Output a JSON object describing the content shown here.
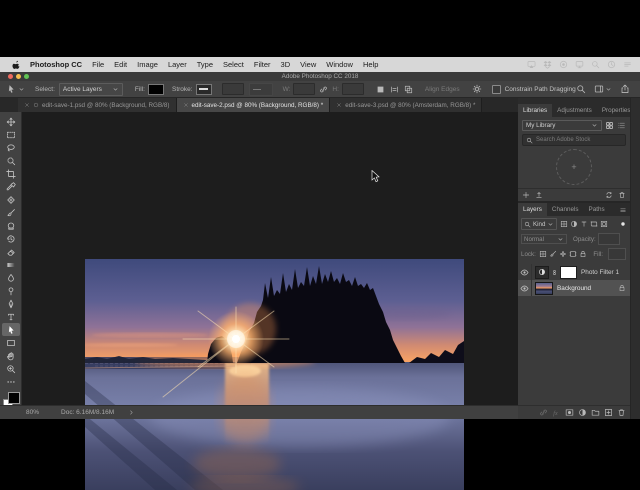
{
  "colors": {
    "menubar_bg": "#d7d7d7",
    "titlebar_bg": "#3a3a3a",
    "panel_bg": "#3b3b3b",
    "canvas_bg": "#1d1d1d",
    "selected_layer_bg": "#525252",
    "traffic_red": "#ee6a5f",
    "traffic_yellow": "#f5bd4f",
    "traffic_green": "#61c354"
  },
  "menu_bar": {
    "app_menu": "Photoshop CC",
    "items": [
      "File",
      "Edit",
      "Image",
      "Layer",
      "Type",
      "Select",
      "Filter",
      "3D",
      "View",
      "Window",
      "Help"
    ],
    "status_icons": [
      "airplay-icon",
      "dropbox-icon",
      "screen-record-icon",
      "display-icon",
      "spotlight-icon",
      "clock-icon",
      "notification-list-icon"
    ]
  },
  "window_title": "Adobe Photoshop CC 2018",
  "options_bar": {
    "select_label": "Select:",
    "select_value": "Active Layers",
    "fill_label": "Fill:",
    "stroke_label": "Stroke:",
    "w_label": "W:",
    "h_label": "H:",
    "align_edges_label": "Align Edges",
    "constrain_label": "Constrain Path Dragging"
  },
  "document_tabs": [
    {
      "title": "edit-save-1.psd @ 80% (Background, RGB/8)",
      "active": false,
      "status_icon": true
    },
    {
      "title": "edit-save-2.psd @ 80% (Background, RGB/8) *",
      "active": true,
      "status_icon": false
    },
    {
      "title": "edit-save-3.psd @ 80% (Amsterdam, RGB/8) *",
      "active": false,
      "status_icon": false
    }
  ],
  "toolbar": {
    "selected_tool": "path-selection-tool",
    "tools": [
      "move-tool",
      "marquee-tool",
      "lasso-tool",
      "quick-selection-tool",
      "crop-tool",
      "eyedropper-tool",
      "spot-healing-tool",
      "brush-tool",
      "clone-stamp-tool",
      "history-brush-tool",
      "eraser-tool",
      "gradient-tool",
      "blur-tool",
      "dodge-tool",
      "pen-tool",
      "type-tool",
      "path-selection-tool",
      "rectangle-tool",
      "hand-tool",
      "zoom-tool",
      "edit-toolbar-ellipsis"
    ]
  },
  "canvas": {
    "photo_description": "Sunset beach with silhouetted tree-topped sea stack, sun star between rocks, wet-sand reflections"
  },
  "libraries_panel": {
    "tabs": [
      "Libraries",
      "Adjustments",
      "Properties"
    ],
    "active_tab": 0,
    "library_name": "My Library",
    "search_placeholder": "Search Adobe Stock",
    "footer_icons_left": [
      "new-library-item-icon",
      "share-library-icon"
    ],
    "footer_icons_right": [
      "sync-library-icon",
      "delete-library-item-icon"
    ]
  },
  "layers_panel": {
    "tabs": [
      "Layers",
      "Channels",
      "Paths"
    ],
    "active_tab": 0,
    "filter_label": "Kind",
    "filter_icons": [
      "pixel-layer-filter-icon",
      "adjustment-layer-filter-icon",
      "type-layer-filter-icon",
      "shape-layer-filter-icon",
      "smart-object-filter-icon"
    ],
    "blend_mode": "Normal",
    "opacity_label": "Opacity:",
    "lock_label": "Lock:",
    "lock_icons": [
      "lock-transparency-icon",
      "lock-pixels-icon",
      "lock-position-icon",
      "lock-artboard-icon",
      "lock-all-icon"
    ],
    "fill_label": "Fill:",
    "layers": [
      {
        "name": "Photo Filter 1",
        "kind": "adjustment",
        "visible": true,
        "selected": false,
        "locked": false
      },
      {
        "name": "Background",
        "kind": "image",
        "visible": true,
        "selected": true,
        "locked": true
      }
    ],
    "footer_icons": [
      "link-layers-icon",
      "layer-effects-icon",
      "layer-mask-icon",
      "new-adjustment-layer-icon",
      "layer-group-icon",
      "new-layer-icon",
      "delete-layer-icon"
    ]
  },
  "status_bar": {
    "zoom_value": "80%",
    "doc_label": "Doc: 6.16M/8.16M"
  }
}
